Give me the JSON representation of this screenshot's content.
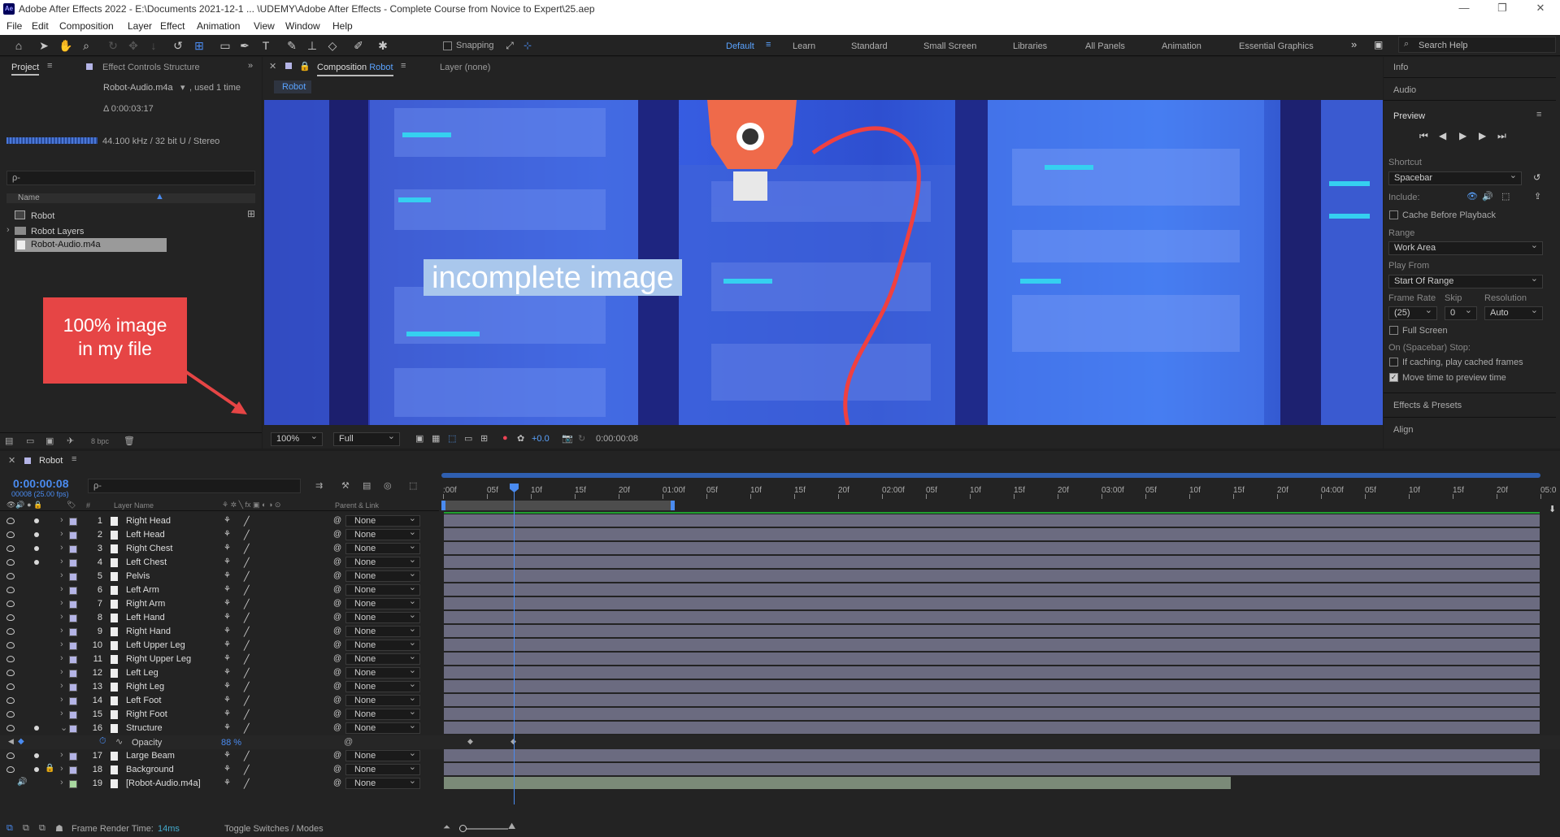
{
  "titlebar": {
    "app_badge": "Ae",
    "title": "Adobe After Effects 2022 - E:\\Documents 2021-12-1 ... \\UDEMY\\Adobe After Effects - Complete Course from Novice to Expert\\25.aep"
  },
  "menu": [
    "File",
    "Edit",
    "Composition",
    "Layer",
    "Effect",
    "Animation",
    "View",
    "Window",
    "Help"
  ],
  "toolbar": {
    "snapping_label": "Snapping",
    "search_placeholder": "Search Help",
    "workspaces": [
      "Default",
      "Learn",
      "Standard",
      "Small Screen",
      "Libraries",
      "All Panels",
      "Animation",
      "Essential Graphics"
    ],
    "active_workspace": "Default"
  },
  "project": {
    "tab1": "Project",
    "tab2": "Effect Controls Structure",
    "selected_file": "Robot-Audio.m4a",
    "used": ", used 1 time",
    "duration": "Δ 0:00:03:17",
    "audio_info": "44.100 kHz / 32 bit U / Stereo",
    "search_placeholder": "ρ-",
    "col_name": "Name",
    "items": [
      "Robot",
      "Robot Layers",
      "Robot-Audio.m4a"
    ],
    "bpc": "8 bpc"
  },
  "annotation": {
    "text1": "100% image",
    "text2": "in my file"
  },
  "viewer": {
    "tab": "Composition",
    "tab_name": "Robot",
    "layer_tab": "Layer (none)",
    "breadcrumb": "Robot",
    "overlay_text": "incomplete image",
    "zoom": "100%",
    "resolution": "Full",
    "exposure": "+0.0",
    "timecode": "0:00:00:08"
  },
  "right": {
    "info": "Info",
    "audio": "Audio",
    "preview": "Preview",
    "shortcut_label": "Shortcut",
    "shortcut": "Spacebar",
    "include_label": "Include:",
    "cache_before": "Cache Before Playback",
    "range_label": "Range",
    "range": "Work Area",
    "play_from_label": "Play From",
    "play_from": "Start Of Range",
    "frame_rate_label": "Frame Rate",
    "skip_label": "Skip",
    "resolution_label": "Resolution",
    "frame_rate": "(25)",
    "skip": "0",
    "resolution": "Auto",
    "full_screen": "Full Screen",
    "stop_label": "On (Spacebar) Stop:",
    "if_caching": "If caching, play cached frames",
    "move_time": "Move time to preview time",
    "effects": "Effects & Presets",
    "align": "Align"
  },
  "timeline": {
    "comp": "Robot",
    "timecode": "0:00:00:08",
    "frames": "00008 (25.00 fps)",
    "search": "ρ-",
    "col_layer": "Layer Name",
    "col_num": "#",
    "col_parent": "Parent & Link",
    "ruler": [
      ":00f",
      "05f",
      "10f",
      "15f",
      "20f",
      "01:00f",
      "05f",
      "10f",
      "15f",
      "20f",
      "02:00f",
      "05f",
      "10f",
      "15f",
      "20f",
      "03:00f",
      "05f",
      "10f",
      "15f",
      "20f",
      "04:00f",
      "05f",
      "10f",
      "15f",
      "20f",
      "05:0"
    ],
    "layers": [
      {
        "n": "1",
        "name": "Right Head",
        "parent": "None"
      },
      {
        "n": "2",
        "name": "Left Head",
        "parent": "None"
      },
      {
        "n": "3",
        "name": "Right Chest",
        "parent": "None"
      },
      {
        "n": "4",
        "name": "Left Chest",
        "parent": "None"
      },
      {
        "n": "5",
        "name": "Pelvis",
        "parent": "None"
      },
      {
        "n": "6",
        "name": "Left Arm",
        "parent": "None"
      },
      {
        "n": "7",
        "name": "Right Arm",
        "parent": "None"
      },
      {
        "n": "8",
        "name": "Left Hand",
        "parent": "None"
      },
      {
        "n": "9",
        "name": "Right Hand",
        "parent": "None"
      },
      {
        "n": "10",
        "name": "Left Upper Leg",
        "parent": "None"
      },
      {
        "n": "11",
        "name": "Right Upper Leg",
        "parent": "None"
      },
      {
        "n": "12",
        "name": "Left Leg",
        "parent": "None"
      },
      {
        "n": "13",
        "name": "Right Leg",
        "parent": "None"
      },
      {
        "n": "14",
        "name": "Left Foot",
        "parent": "None"
      },
      {
        "n": "15",
        "name": "Right Foot",
        "parent": "None"
      },
      {
        "n": "16",
        "name": "Structure",
        "parent": "None"
      }
    ],
    "opacity_label": "Opacity",
    "opacity_value": "88 %",
    "layers2": [
      {
        "n": "17",
        "name": "Large Beam",
        "parent": "None"
      },
      {
        "n": "18",
        "name": "Background",
        "parent": "None"
      },
      {
        "n": "19",
        "name": "[Robot-Audio.m4a]",
        "parent": "None"
      }
    ],
    "render_label": "Frame Render Time:",
    "render_value": "14ms",
    "toggle": "Toggle Switches / Modes"
  }
}
